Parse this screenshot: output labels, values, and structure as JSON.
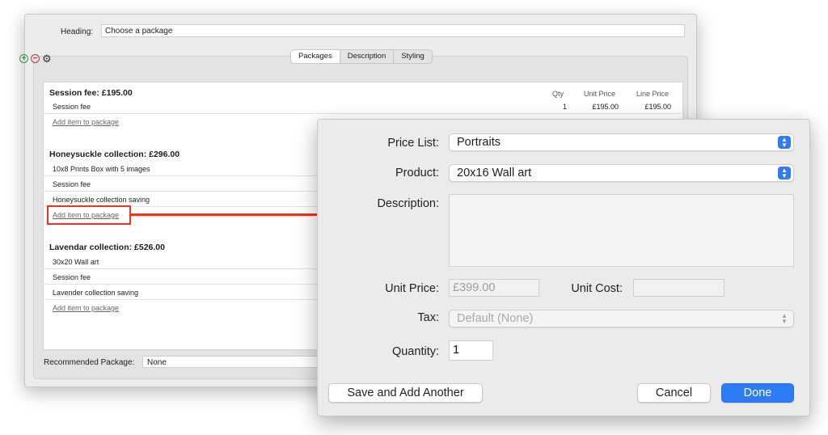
{
  "background_window": {
    "heading_label": "Heading:",
    "heading_value": "Choose a package",
    "tabs": [
      {
        "label": "Packages"
      },
      {
        "label": "Description"
      },
      {
        "label": "Styling"
      }
    ],
    "columns": {
      "qty": "Qty",
      "unit_price": "Unit Price",
      "line_price": "Line Price"
    },
    "packages": [
      {
        "title": "Session fee: £195.00",
        "items": [
          {
            "name": "Session fee",
            "qty": "1",
            "unit_price": "£195.00",
            "line_price": "£195.00"
          }
        ],
        "add_link": "Add item to package"
      },
      {
        "title": "Honeysuckle collection: £296.00",
        "items": [
          {
            "name": "10x8 Prints Box with 5 images"
          },
          {
            "name": "Session fee"
          },
          {
            "name": "Honeysuckle collection saving"
          }
        ],
        "add_link": "Add item to package"
      },
      {
        "title": "Lavendar collection: £526.00",
        "items": [
          {
            "name": "30x20 Wall art"
          },
          {
            "name": "Session fee"
          },
          {
            "name": "Lavender collection saving"
          }
        ],
        "add_link": "Add item to package"
      }
    ],
    "recommended_label": "Recommended Package:",
    "recommended_value": "None"
  },
  "dialog": {
    "price_list_label": "Price List:",
    "price_list_value": "Portraits",
    "product_label": "Product:",
    "product_value": "20x16 Wall art",
    "description_label": "Description:",
    "description_value": "",
    "unit_price_label": "Unit Price:",
    "unit_price_value": "£399.00",
    "unit_cost_label": "Unit Cost:",
    "unit_cost_value": "",
    "tax_label": "Tax:",
    "tax_value": "Default (None)",
    "quantity_label": "Quantity:",
    "quantity_value": "1",
    "save_add_another": "Save and Add Another",
    "cancel": "Cancel",
    "done": "Done"
  },
  "colors": {
    "accent": "#2d7cf6",
    "highlight": "#e8371f"
  },
  "icons": [
    "add-icon",
    "remove-icon",
    "gear-icon",
    "stepper-icon"
  ]
}
